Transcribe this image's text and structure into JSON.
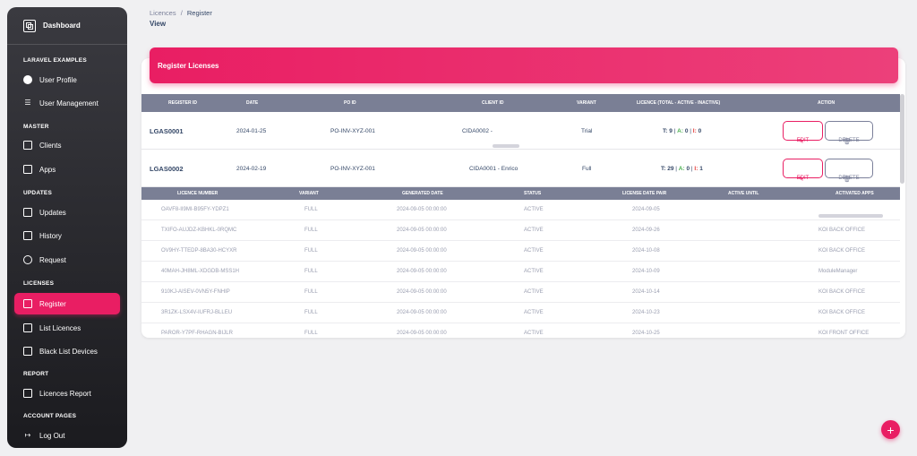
{
  "sidebar": {
    "brand": "Dashboard",
    "sections": {
      "laravel": "LARAVEL EXAMPLES",
      "master": "MASTER",
      "updates": "UPDATES",
      "licenses": "LICENSES",
      "report": "REPORT",
      "account": "ACCOUNT PAGES"
    },
    "items": {
      "user_profile": "User Profile",
      "user_management": "User Management",
      "clients": "Clients",
      "apps": "Apps",
      "updates": "Updates",
      "history": "History",
      "request": "Request",
      "register": "Register",
      "list_licences": "List Licences",
      "black_list": "Black List Devices",
      "licences_report": "Licences Report",
      "logout": "Log Out"
    }
  },
  "breadcrumb": {
    "parent": "Licences",
    "sep": "/",
    "current": "Register"
  },
  "page_title": "View",
  "card_title": "Register Licenses",
  "register_columns": [
    "REGISTER ID",
    "DATE",
    "PO ID",
    "CLIENT ID",
    "VARIANT",
    "LICENCE (TOTAL - ACTIVE - INACTIVE)",
    "ACTION"
  ],
  "registers": [
    {
      "id": "LGAS0001",
      "date": "2024-01-25",
      "po": "PO-INV-XYZ-001",
      "client": "CIDA0002 -",
      "variant": "Trial",
      "t_label": "T:",
      "t": "9",
      "a_label": "A:",
      "a": "0",
      "i_label": "I:",
      "i": "0"
    },
    {
      "id": "LGAS0002",
      "date": "2024-02-19",
      "po": "PO-INV-XYZ-001",
      "client": "CIDA0001 - Enrico",
      "variant": "Full",
      "t_label": "T:",
      "t": "29",
      "a_label": "A:",
      "a": "0",
      "i_label": "I:",
      "i": "1"
    }
  ],
  "actions": {
    "edit": "EDIT",
    "delete": "DELETE"
  },
  "licence_columns": [
    "LICENCE NUMBER",
    "VARIANT",
    "GENERATED DATE",
    "STATUS",
    "LICENSE DATE PAIR",
    "ACTIVE UNTIL",
    "ACTIVATED APPS"
  ],
  "licences": [
    {
      "number": "OAVF8-II9MI-B95FY-YDPZ1",
      "variant": "FULL",
      "generated": "2024-09-05 00:00:00",
      "status": "ACTIVE",
      "pair": "2024-09-05",
      "until": "",
      "apps": ""
    },
    {
      "number": "TXIFO-AUJDZ-KBHKL-0RQMC",
      "variant": "FULL",
      "generated": "2024-09-05 00:00:00",
      "status": "ACTIVE",
      "pair": "2024-09-26",
      "until": "",
      "apps": "KOI BACK OFFICE"
    },
    {
      "number": "OV9HY-TTEDP-8BA30-HCYXR",
      "variant": "FULL",
      "generated": "2024-09-05 00:00:00",
      "status": "ACTIVE",
      "pair": "2024-10-08",
      "until": "",
      "apps": "KOI BACK OFFICE"
    },
    {
      "number": "40MAH-JH8ML-XDGDB-MSS1H",
      "variant": "FULL",
      "generated": "2024-09-05 00:00:00",
      "status": "ACTIVE",
      "pair": "2024-10-09",
      "until": "",
      "apps": "ModuleManager"
    },
    {
      "number": "910KJ-AISEV-0VN5Y-FNHIP",
      "variant": "FULL",
      "generated": "2024-09-05 00:00:00",
      "status": "ACTIVE",
      "pair": "2024-10-14",
      "until": "",
      "apps": "KOI BACK OFFICE"
    },
    {
      "number": "3R1ZK-LSX4V-IUFRJ-BLLEU",
      "variant": "FULL",
      "generated": "2024-09-05 00:00:00",
      "status": "ACTIVE",
      "pair": "2024-10-23",
      "until": "",
      "apps": "KOI BACK OFFICE"
    },
    {
      "number": "PAROR-Y7PF-RHAGN-BIJLR",
      "variant": "FULL",
      "generated": "2024-09-05 00:00:00",
      "status": "ACTIVE",
      "pair": "2024-10-25",
      "until": "",
      "apps": "KOI FRONT OFFICE"
    }
  ],
  "fab": "+",
  "colors": {
    "accent": "#e91e63",
    "sidebar": "#1b1b1f",
    "header_row": "#7a7f95",
    "active_green": "#4caf50",
    "inactive_red": "#e53935"
  }
}
